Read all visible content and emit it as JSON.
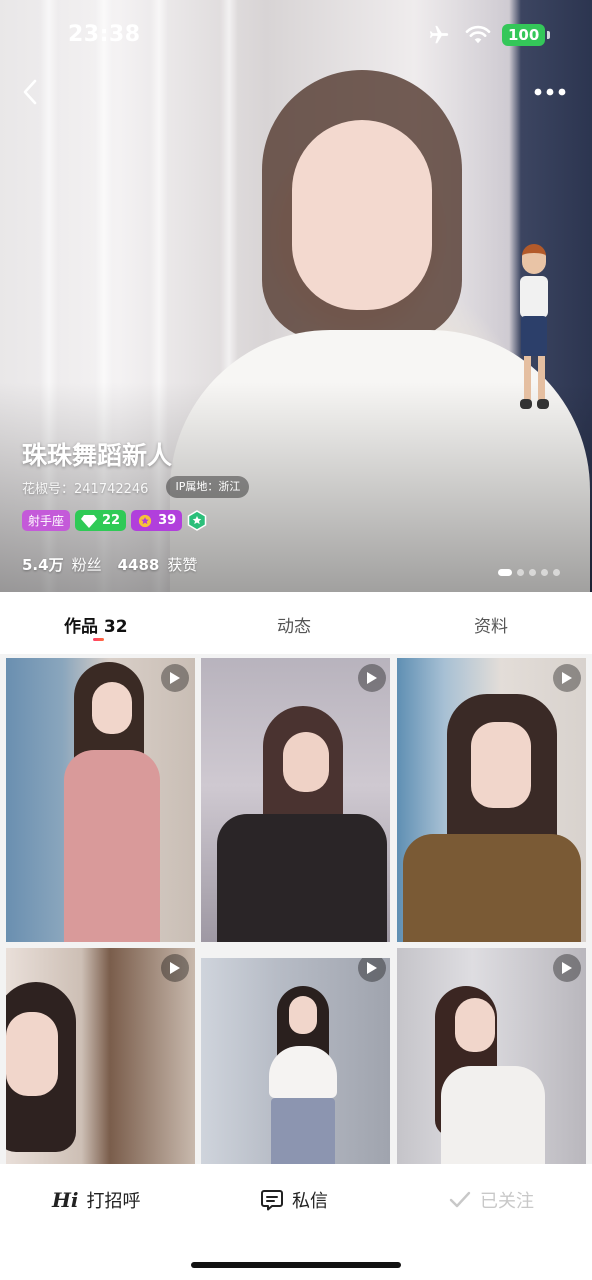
{
  "status_bar": {
    "time": "23:38",
    "battery": "100"
  },
  "profile": {
    "nickname": "珠珠舞蹈新人",
    "user_id": "花椒号：241742246",
    "ip_location": "IP属地：浙江",
    "badges": {
      "zodiac": "射手座",
      "level": "22",
      "wealth": "39"
    },
    "followers_count": "5.4万",
    "followers_label": "粉丝",
    "likes_count": "4488",
    "likes_label": "获赞"
  },
  "tabs": {
    "works": "作品 32",
    "moments": "动态",
    "info": "资料"
  },
  "grid": {
    "items": [
      {
        "type": "video"
      },
      {
        "type": "video"
      },
      {
        "type": "video"
      },
      {
        "type": "video"
      },
      {
        "type": "video"
      },
      {
        "type": "video"
      }
    ]
  },
  "bottom_bar": {
    "greet_mark": "Hi",
    "greet_label": "打招呼",
    "message_label": "私信",
    "followed_label": "已关注"
  },
  "colors": {
    "level_badge": "#2fca56",
    "wealth_badge": "#b13fdc",
    "zodiac_badge": "#c45ad9",
    "accent": "#ff3b6b"
  }
}
